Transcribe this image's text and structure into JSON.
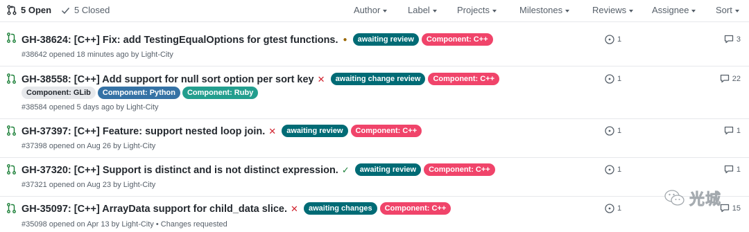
{
  "header": {
    "open": {
      "count": "5",
      "label": "Open"
    },
    "closed": {
      "count": "5",
      "label": "Closed"
    },
    "filters": [
      "Author",
      "Label",
      "Projects",
      "Milestones",
      "Reviews",
      "Assignee",
      "Sort"
    ]
  },
  "pulls": [
    {
      "title": "GH-38624: [C++] Fix: add TestingEqualOptions for gtest functions.",
      "status_icon": "dot-icon",
      "status_glyph": "●",
      "labels": [
        "awaiting review",
        "Component: C++"
      ],
      "labels2": [],
      "meta": "#38642 opened 18 minutes ago by Light-City",
      "reviews": "1",
      "comments": "3"
    },
    {
      "title": "GH-38558: [C++] Add support for null sort option per sort key",
      "status_icon": "x-icon",
      "status_glyph": "✕",
      "labels": [
        "awaiting change review",
        "Component: C++"
      ],
      "labels2": [
        "Component: GLib",
        "Component: Python",
        "Component: Ruby"
      ],
      "meta": "#38584 opened 5 days ago by Light-City",
      "reviews": "1",
      "comments": "22"
    },
    {
      "title": "GH-37397: [C++] Feature: support nested loop join.",
      "status_icon": "x-icon",
      "status_glyph": "✕",
      "labels": [
        "awaiting review",
        "Component: C++"
      ],
      "labels2": [],
      "meta": "#37398 opened on Aug 26 by Light-City",
      "reviews": "1",
      "comments": "1"
    },
    {
      "title": "GH-37320: [C++] Support is distinct and is not distinct expression.",
      "status_icon": "check-icon",
      "status_glyph": "✓",
      "labels": [
        "awaiting review",
        "Component: C++"
      ],
      "labels2": [],
      "meta": "#37321 opened on Aug 23 by Light-City",
      "reviews": "1",
      "comments": "1"
    },
    {
      "title": "GH-35097: [C++] ArrayData support for child_data slice.",
      "status_icon": "x-icon",
      "status_glyph": "✕",
      "labels": [
        "awaiting changes",
        "Component: C++"
      ],
      "labels2": [],
      "meta": "#35098 opened on Apr 13 by Light-City • Changes requested",
      "reviews": "1",
      "comments": "15"
    }
  ],
  "watermark": {
    "text": "光城"
  },
  "colors": {
    "open_icon": "#1a7f37",
    "awaiting": "#006b75",
    "cpp": "#f0446a",
    "python": "#3572a5",
    "ruby": "#239e8e",
    "glib": "#e6e8eb"
  }
}
